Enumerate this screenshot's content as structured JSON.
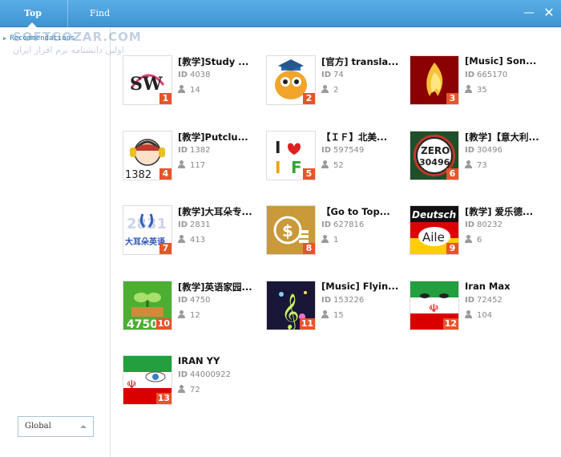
{
  "header": {
    "tabs": [
      {
        "label": "Top"
      },
      {
        "label": "Find"
      }
    ],
    "minimize_glyph": "—",
    "close_glyph": "✕"
  },
  "sidebar": {
    "items": [
      {
        "label": "Recommendations"
      }
    ],
    "watermark_text": "SOFTGOZAR.COM",
    "watermark_sub": "اولین دانشنامه نرم افزار ایران",
    "region_select": {
      "value": "Global"
    }
  },
  "colors": {
    "accent": "#3e93d3",
    "badge": "#e8542a"
  },
  "rooms": [
    {
      "rank": "1",
      "name": "[教学]Study ...",
      "id": "4038",
      "users": "14",
      "icon": "sw-logo-icon"
    },
    {
      "rank": "2",
      "name": "[官方] transla...",
      "id": "74",
      "users": "2",
      "icon": "owl-teacher-icon"
    },
    {
      "rank": "3",
      "name": "[Music] Son...",
      "id": "665170",
      "users": "35",
      "icon": "music-flame-icon"
    },
    {
      "rank": "4",
      "name": "[教学]Putclu...",
      "id": "1382",
      "users": "117",
      "icon": "headphone-avatar-icon"
    },
    {
      "rank": "5",
      "name": "【ＩＦ】北美...",
      "id": "597549",
      "users": "52",
      "icon": "i-love-f-icon"
    },
    {
      "rank": "6",
      "name": "[教学]【意大利...",
      "id": "30496",
      "users": "73",
      "icon": "zero-30496-icon"
    },
    {
      "rank": "7",
      "name": "[教学]大耳朵专...",
      "id": "2831",
      "users": "413",
      "icon": "big-ear-english-icon"
    },
    {
      "rank": "8",
      "name": "【Go to Top...",
      "id": "627816",
      "users": "1",
      "icon": "coin-stack-icon"
    },
    {
      "rank": "9",
      "name": "[教学] 爱乐德...",
      "id": "80232",
      "users": "6",
      "icon": "deutsch-aile-icon"
    },
    {
      "rank": "10",
      "name": "[教学]英语家园...",
      "id": "4750",
      "users": "12",
      "icon": "sprout-4750-icon"
    },
    {
      "rank": "11",
      "name": "[Music] Flyin...",
      "id": "153226",
      "users": "15",
      "icon": "treble-clef-icon"
    },
    {
      "rank": "12",
      "name": "Iran Max",
      "id": "72452",
      "users": "104",
      "icon": "iran-flag-face-icon"
    },
    {
      "rank": "13",
      "name": "IRAN YY",
      "id": "44000922",
      "users": "72",
      "icon": "iran-flag-eye-icon"
    }
  ],
  "labels": {
    "id": "ID"
  }
}
